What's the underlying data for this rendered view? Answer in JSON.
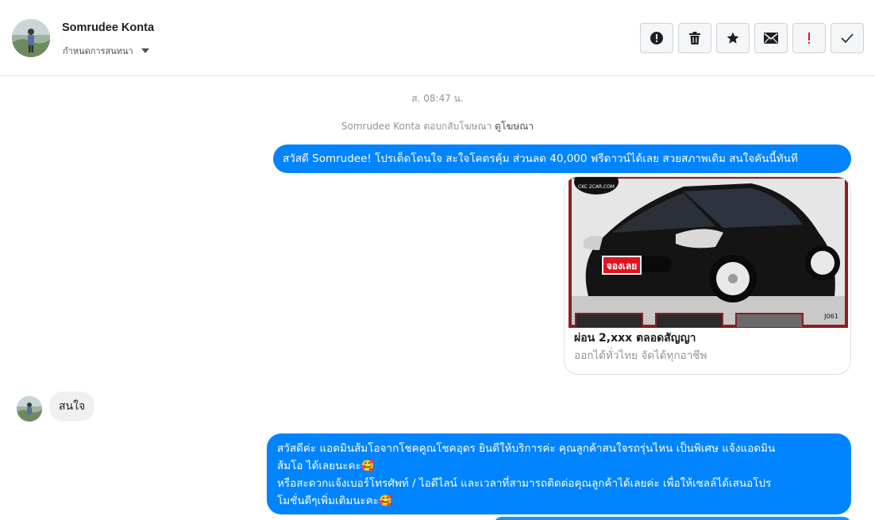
{
  "header": {
    "contact_name": "Somrudee Konta",
    "assign_label": "กำหนดการสนทนา",
    "actions": [
      {
        "name": "mark-spam-button",
        "icon": "alert-circle-icon"
      },
      {
        "name": "delete-button",
        "icon": "trash-icon"
      },
      {
        "name": "star-button",
        "icon": "star-icon"
      },
      {
        "name": "mark-unread-button",
        "icon": "envelope-icon"
      },
      {
        "name": "mark-important-button",
        "icon": "exclamation-icon"
      },
      {
        "name": "mark-done-button",
        "icon": "checkmark-icon"
      }
    ]
  },
  "conversation": {
    "timestamp": "ส. 08:47 น.",
    "reply_note": {
      "prefix": "Somrudee Konta ตอบกลับโฆษณา",
      "link": "ดูโฆษณา"
    },
    "messages": [
      {
        "direction": "outgoing",
        "text": "สวัสดี Somrudee! โปรเด็ดโดนใจ สะใจโคตรคุ้ม ส่วนลด 40,000 ฟรีดาวน์ได้เลย สวยสภาพเดิม สนใจคันนี้ทันที"
      },
      {
        "direction": "incoming",
        "text": "สนใจ"
      },
      {
        "direction": "outgoing",
        "lines": [
          "สวัสดีค่ะ แอดมินส้มโอจากโชคคูณโชคอุดร ยินดีให้บริการค่ะ  คุณลูกค้าสนใจรถรุ่นไหน เป็นพิเศษ แจ้งแอดมิน",
          "ส้มโอ ได้เลยนะคะ🥰",
          "หรือสะดวกแจ้งเบอร์โทรศัพท์ / ไอดีไลน์ และเวลาที่สามารถติดต่อคุณลูกค้าได้เลยค่ะ เพื่อให้เซลล์ได้เสนอโปร",
          "โมชั่นดีๆเพิ่มเติมนะคะ🥰"
        ]
      }
    ],
    "ad_card": {
      "title": "ผ่อน 2,xxx ตลอดสัญญา",
      "subtitle": "ออกได้ทั่วไทย จัดได้ทุกอาชีพ",
      "image_badge": "จองเลย",
      "image_logo": "CKC 2CAR.COM",
      "image_code": "J061"
    }
  },
  "colors": {
    "outgoing_bubble": "#0084ff",
    "incoming_bubble": "#f1f0f0",
    "badge_red": "#e0141f",
    "alert_red": "#e0141f"
  }
}
